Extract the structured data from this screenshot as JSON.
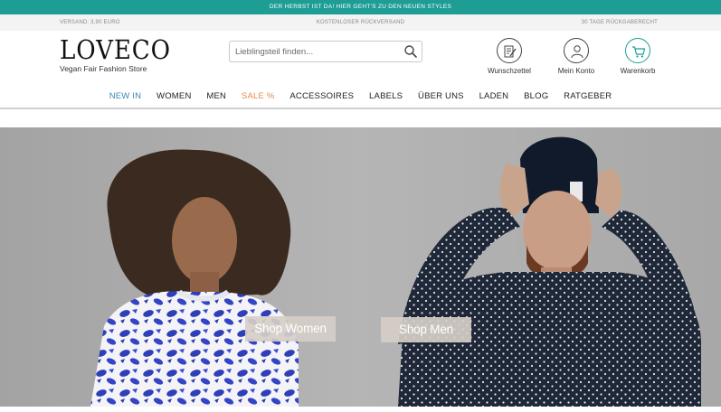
{
  "promo": {
    "text": "DER HERBST IST DA! HIER GEHT'S ZU DEN NEUEN STYLES"
  },
  "info": {
    "left": "VERSAND: 3,90 EURO",
    "center": "KOSTENLOSER RÜCKVERSAND",
    "right": "30 TAGE RÜCKGABERECHT"
  },
  "header": {
    "logo": "LOVECO",
    "tagline": "Vegan Fair Fashion Store",
    "search_placeholder": "Lieblingsteil finden...",
    "wishlist_label": "Wunschzettel",
    "account_label": "Mein Konto",
    "cart_label": "Warenkorb"
  },
  "nav": {
    "items": [
      "NEW IN",
      "WOMEN",
      "MEN",
      "SALE %",
      "ACCESSOIRES",
      "LABELS",
      "ÜBER UNS",
      "LADEN",
      "BLOG",
      "RATGEBER"
    ]
  },
  "hero": {
    "women_button": "Shop Women",
    "men_button": "Shop Men"
  },
  "colors": {
    "accent": "#1e9d95",
    "new_in": "#3a86b5",
    "sale": "#e8884f",
    "hero_button": "#d6cec8"
  },
  "icons": [
    "search-icon",
    "wishlist-icon",
    "account-icon",
    "cart-icon"
  ]
}
